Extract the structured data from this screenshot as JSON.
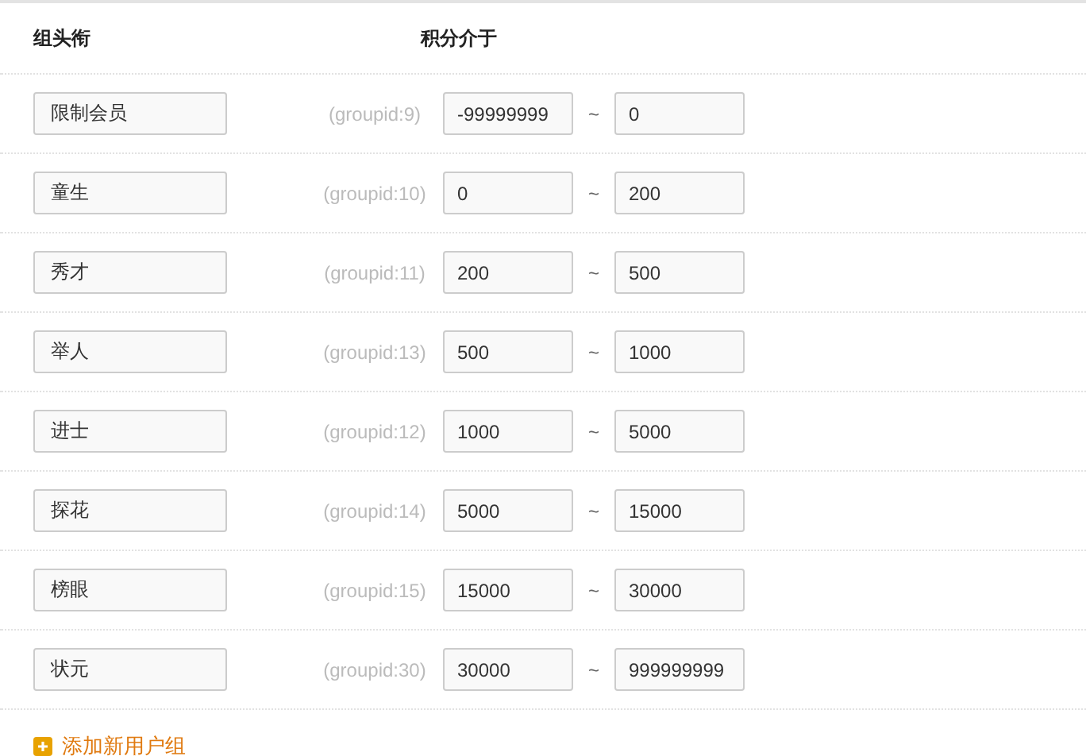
{
  "table": {
    "columns": [
      "组头衔",
      "积分介于"
    ],
    "rows": [
      {
        "title": "限制会员",
        "groupid": "(groupid:9)",
        "min": "-99999999",
        "max": "0"
      },
      {
        "title": "童生",
        "groupid": "(groupid:10)",
        "min": "0",
        "max": "200"
      },
      {
        "title": "秀才",
        "groupid": "(groupid:11)",
        "min": "200",
        "max": "500"
      },
      {
        "title": "举人",
        "groupid": "(groupid:13)",
        "min": "500",
        "max": "1000"
      },
      {
        "title": "进士",
        "groupid": "(groupid:12)",
        "min": "1000",
        "max": "5000"
      },
      {
        "title": "探花",
        "groupid": "(groupid:14)",
        "min": "5000",
        "max": "15000"
      },
      {
        "title": "榜眼",
        "groupid": "(groupid:15)",
        "min": "15000",
        "max": "30000"
      },
      {
        "title": "状元",
        "groupid": "(groupid:30)",
        "min": "30000",
        "max": "999999999"
      }
    ],
    "separator": "~"
  },
  "add_link": "添加新用户组"
}
